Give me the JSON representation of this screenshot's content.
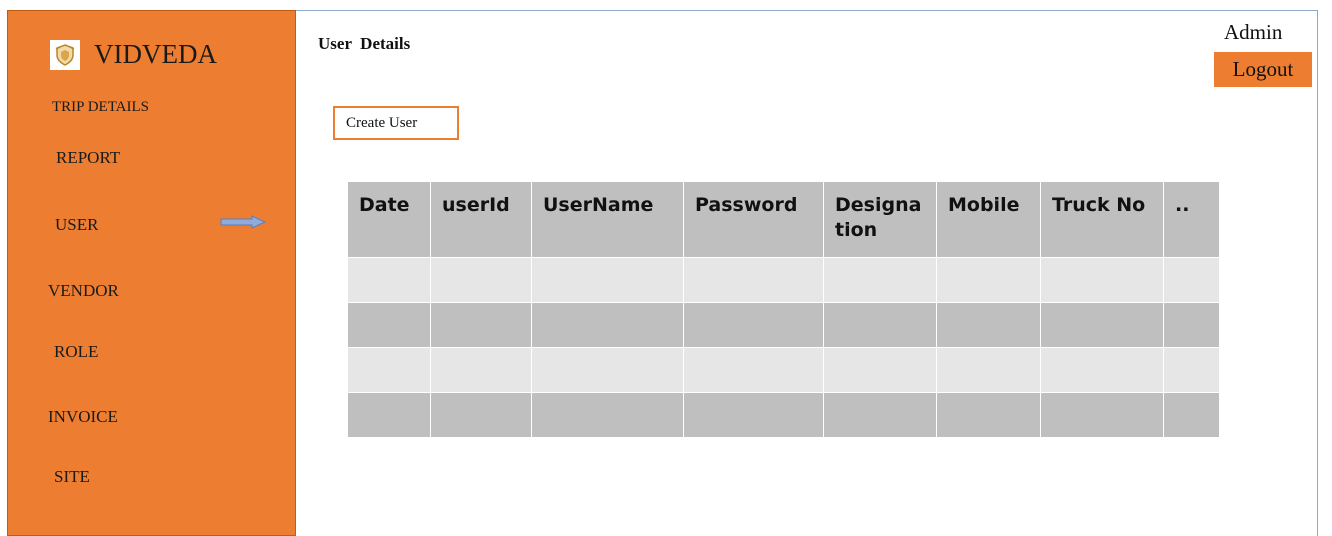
{
  "brand": {
    "name": "VIDVEDA"
  },
  "nav": {
    "trip_details": "TRIP DETAILS",
    "report": "REPORT",
    "user": "USER",
    "vendor": "VENDOR",
    "role": "ROLE",
    "invoice": "INVOICE",
    "site": "SITE",
    "active_indicator_icon": "right-arrow-icon"
  },
  "header": {
    "title": "User  Details",
    "admin_label": "Admin",
    "logout_label": "Logout"
  },
  "toolbar": {
    "create_user_label": "Create User"
  },
  "table": {
    "columns": [
      "Date",
      "userId",
      "UserName",
      "Password",
      "Designa tion",
      "Mobile",
      "Truck No",
      ".."
    ],
    "rows": [
      [
        "",
        "",
        "",
        "",
        "",
        "",
        "",
        ""
      ],
      [
        "",
        "",
        "",
        "",
        "",
        "",
        "",
        ""
      ],
      [
        "",
        "",
        "",
        "",
        "",
        "",
        "",
        ""
      ],
      [
        "",
        "",
        "",
        "",
        "",
        "",
        "",
        ""
      ]
    ]
  },
  "colors": {
    "accent": "#ed7d31",
    "header_cell": "#bfbfbf",
    "row_light": "#e6e6e6",
    "row_dark": "#bfbfbf"
  }
}
